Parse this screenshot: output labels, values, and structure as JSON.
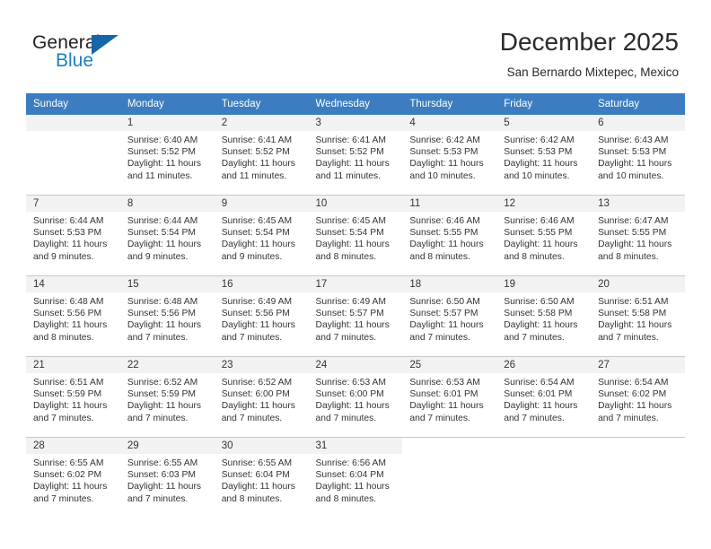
{
  "brand": {
    "name_part1": "General",
    "name_part2": "Blue",
    "triangle_color": "#1565a8",
    "blue_color": "#1b7dc4"
  },
  "header": {
    "title": "December 2025",
    "location": "San Bernardo Mixtepec, Mexico"
  },
  "theme": {
    "header_row_bg": "#3b7dc0",
    "header_row_text": "#ffffff",
    "daynum_band_bg": "#f2f2f2",
    "grid_line": "#c8c8c8",
    "body_text": "#333333"
  },
  "weekday_headers": [
    "Sunday",
    "Monday",
    "Tuesday",
    "Wednesday",
    "Thursday",
    "Friday",
    "Saturday"
  ],
  "weeks": [
    [
      {
        "day": "",
        "empty": true,
        "sunrise": "",
        "sunset": "",
        "daylight_l1": "",
        "daylight_l2": ""
      },
      {
        "day": "1",
        "sunrise": "Sunrise: 6:40 AM",
        "sunset": "Sunset: 5:52 PM",
        "daylight_l1": "Daylight: 11 hours",
        "daylight_l2": "and 11 minutes."
      },
      {
        "day": "2",
        "sunrise": "Sunrise: 6:41 AM",
        "sunset": "Sunset: 5:52 PM",
        "daylight_l1": "Daylight: 11 hours",
        "daylight_l2": "and 11 minutes."
      },
      {
        "day": "3",
        "sunrise": "Sunrise: 6:41 AM",
        "sunset": "Sunset: 5:52 PM",
        "daylight_l1": "Daylight: 11 hours",
        "daylight_l2": "and 11 minutes."
      },
      {
        "day": "4",
        "sunrise": "Sunrise: 6:42 AM",
        "sunset": "Sunset: 5:53 PM",
        "daylight_l1": "Daylight: 11 hours",
        "daylight_l2": "and 10 minutes."
      },
      {
        "day": "5",
        "sunrise": "Sunrise: 6:42 AM",
        "sunset": "Sunset: 5:53 PM",
        "daylight_l1": "Daylight: 11 hours",
        "daylight_l2": "and 10 minutes."
      },
      {
        "day": "6",
        "sunrise": "Sunrise: 6:43 AM",
        "sunset": "Sunset: 5:53 PM",
        "daylight_l1": "Daylight: 11 hours",
        "daylight_l2": "and 10 minutes."
      }
    ],
    [
      {
        "day": "7",
        "sunrise": "Sunrise: 6:44 AM",
        "sunset": "Sunset: 5:53 PM",
        "daylight_l1": "Daylight: 11 hours",
        "daylight_l2": "and 9 minutes."
      },
      {
        "day": "8",
        "sunrise": "Sunrise: 6:44 AM",
        "sunset": "Sunset: 5:54 PM",
        "daylight_l1": "Daylight: 11 hours",
        "daylight_l2": "and 9 minutes."
      },
      {
        "day": "9",
        "sunrise": "Sunrise: 6:45 AM",
        "sunset": "Sunset: 5:54 PM",
        "daylight_l1": "Daylight: 11 hours",
        "daylight_l2": "and 9 minutes."
      },
      {
        "day": "10",
        "sunrise": "Sunrise: 6:45 AM",
        "sunset": "Sunset: 5:54 PM",
        "daylight_l1": "Daylight: 11 hours",
        "daylight_l2": "and 8 minutes."
      },
      {
        "day": "11",
        "sunrise": "Sunrise: 6:46 AM",
        "sunset": "Sunset: 5:55 PM",
        "daylight_l1": "Daylight: 11 hours",
        "daylight_l2": "and 8 minutes."
      },
      {
        "day": "12",
        "sunrise": "Sunrise: 6:46 AM",
        "sunset": "Sunset: 5:55 PM",
        "daylight_l1": "Daylight: 11 hours",
        "daylight_l2": "and 8 minutes."
      },
      {
        "day": "13",
        "sunrise": "Sunrise: 6:47 AM",
        "sunset": "Sunset: 5:55 PM",
        "daylight_l1": "Daylight: 11 hours",
        "daylight_l2": "and 8 minutes."
      }
    ],
    [
      {
        "day": "14",
        "sunrise": "Sunrise: 6:48 AM",
        "sunset": "Sunset: 5:56 PM",
        "daylight_l1": "Daylight: 11 hours",
        "daylight_l2": "and 8 minutes."
      },
      {
        "day": "15",
        "sunrise": "Sunrise: 6:48 AM",
        "sunset": "Sunset: 5:56 PM",
        "daylight_l1": "Daylight: 11 hours",
        "daylight_l2": "and 7 minutes."
      },
      {
        "day": "16",
        "sunrise": "Sunrise: 6:49 AM",
        "sunset": "Sunset: 5:56 PM",
        "daylight_l1": "Daylight: 11 hours",
        "daylight_l2": "and 7 minutes."
      },
      {
        "day": "17",
        "sunrise": "Sunrise: 6:49 AM",
        "sunset": "Sunset: 5:57 PM",
        "daylight_l1": "Daylight: 11 hours",
        "daylight_l2": "and 7 minutes."
      },
      {
        "day": "18",
        "sunrise": "Sunrise: 6:50 AM",
        "sunset": "Sunset: 5:57 PM",
        "daylight_l1": "Daylight: 11 hours",
        "daylight_l2": "and 7 minutes."
      },
      {
        "day": "19",
        "sunrise": "Sunrise: 6:50 AM",
        "sunset": "Sunset: 5:58 PM",
        "daylight_l1": "Daylight: 11 hours",
        "daylight_l2": "and 7 minutes."
      },
      {
        "day": "20",
        "sunrise": "Sunrise: 6:51 AM",
        "sunset": "Sunset: 5:58 PM",
        "daylight_l1": "Daylight: 11 hours",
        "daylight_l2": "and 7 minutes."
      }
    ],
    [
      {
        "day": "21",
        "sunrise": "Sunrise: 6:51 AM",
        "sunset": "Sunset: 5:59 PM",
        "daylight_l1": "Daylight: 11 hours",
        "daylight_l2": "and 7 minutes."
      },
      {
        "day": "22",
        "sunrise": "Sunrise: 6:52 AM",
        "sunset": "Sunset: 5:59 PM",
        "daylight_l1": "Daylight: 11 hours",
        "daylight_l2": "and 7 minutes."
      },
      {
        "day": "23",
        "sunrise": "Sunrise: 6:52 AM",
        "sunset": "Sunset: 6:00 PM",
        "daylight_l1": "Daylight: 11 hours",
        "daylight_l2": "and 7 minutes."
      },
      {
        "day": "24",
        "sunrise": "Sunrise: 6:53 AM",
        "sunset": "Sunset: 6:00 PM",
        "daylight_l1": "Daylight: 11 hours",
        "daylight_l2": "and 7 minutes."
      },
      {
        "day": "25",
        "sunrise": "Sunrise: 6:53 AM",
        "sunset": "Sunset: 6:01 PM",
        "daylight_l1": "Daylight: 11 hours",
        "daylight_l2": "and 7 minutes."
      },
      {
        "day": "26",
        "sunrise": "Sunrise: 6:54 AM",
        "sunset": "Sunset: 6:01 PM",
        "daylight_l1": "Daylight: 11 hours",
        "daylight_l2": "and 7 minutes."
      },
      {
        "day": "27",
        "sunrise": "Sunrise: 6:54 AM",
        "sunset": "Sunset: 6:02 PM",
        "daylight_l1": "Daylight: 11 hours",
        "daylight_l2": "and 7 minutes."
      }
    ],
    [
      {
        "day": "28",
        "sunrise": "Sunrise: 6:55 AM",
        "sunset": "Sunset: 6:02 PM",
        "daylight_l1": "Daylight: 11 hours",
        "daylight_l2": "and 7 minutes."
      },
      {
        "day": "29",
        "sunrise": "Sunrise: 6:55 AM",
        "sunset": "Sunset: 6:03 PM",
        "daylight_l1": "Daylight: 11 hours",
        "daylight_l2": "and 7 minutes."
      },
      {
        "day": "30",
        "sunrise": "Sunrise: 6:55 AM",
        "sunset": "Sunset: 6:04 PM",
        "daylight_l1": "Daylight: 11 hours",
        "daylight_l2": "and 8 minutes."
      },
      {
        "day": "31",
        "sunrise": "Sunrise: 6:56 AM",
        "sunset": "Sunset: 6:04 PM",
        "daylight_l1": "Daylight: 11 hours",
        "daylight_l2": "and 8 minutes."
      },
      {
        "day": "",
        "blank": true,
        "sunrise": "",
        "sunset": "",
        "daylight_l1": "",
        "daylight_l2": ""
      },
      {
        "day": "",
        "blank": true,
        "sunrise": "",
        "sunset": "",
        "daylight_l1": "",
        "daylight_l2": ""
      },
      {
        "day": "",
        "blank": true,
        "sunrise": "",
        "sunset": "",
        "daylight_l1": "",
        "daylight_l2": ""
      }
    ]
  ]
}
